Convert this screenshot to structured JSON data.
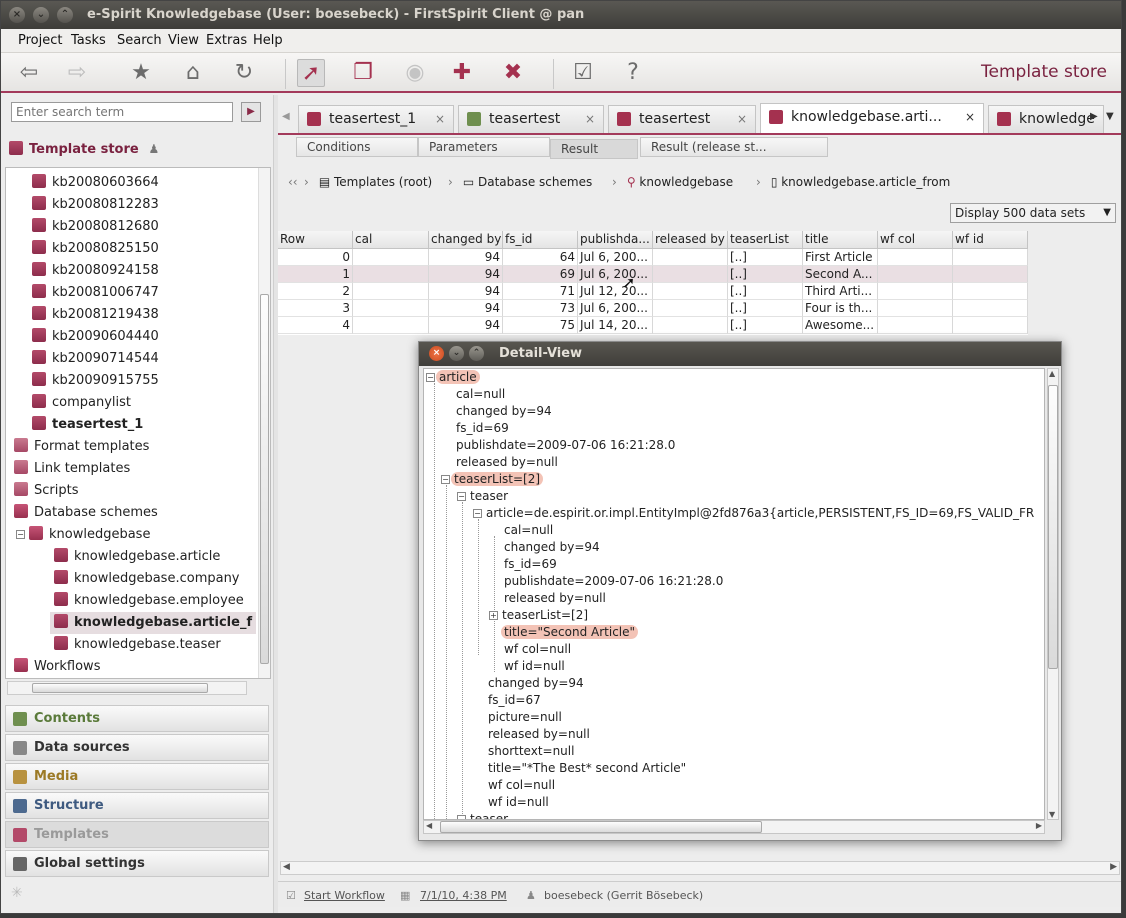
{
  "window": {
    "title": "e-Spirit Knowledgebase (User: boesebeck) - FirstSpirit Client @ pan"
  },
  "menu": [
    "Project",
    "Tasks",
    "Search",
    "View",
    "Extras",
    "Help"
  ],
  "toolbar": {
    "store_title": "Template store",
    "icons": [
      "back-icon",
      "forward-icon",
      "bookmark-star-icon",
      "home-icon",
      "refresh-icon",
      "select-pointer-icon",
      "copy-icon",
      "preview-icon",
      "new-template-icon",
      "delete-icon",
      "workflow-icon",
      "help-icon"
    ]
  },
  "sidebar": {
    "search_placeholder": "Enter search term",
    "store_title": "Template store",
    "tree": [
      {
        "label": "kb20080603664"
      },
      {
        "label": "kb20080812283"
      },
      {
        "label": "kb20080812680"
      },
      {
        "label": "kb20080825150"
      },
      {
        "label": "kb20080924158"
      },
      {
        "label": "kb20081006747"
      },
      {
        "label": "kb20081219438"
      },
      {
        "label": "kb20090604440"
      },
      {
        "label": "kb20090714544"
      },
      {
        "label": "kb20090915755"
      },
      {
        "label": "companylist"
      },
      {
        "label": "teasertest_1"
      },
      {
        "label": "Format templates"
      },
      {
        "label": "Link templates"
      },
      {
        "label": "Scripts"
      },
      {
        "label": "Database schemes"
      },
      {
        "label": "knowledgebase"
      },
      {
        "label": "knowledgebase.article"
      },
      {
        "label": "knowledgebase.company"
      },
      {
        "label": "knowledgebase.employee"
      },
      {
        "label": "knowledgebase.article_f"
      },
      {
        "label": "knowledgebase.teaser"
      },
      {
        "label": "Workflows"
      }
    ],
    "nav": [
      "Contents",
      "Data sources",
      "Media",
      "Structure",
      "Templates",
      "Global settings"
    ]
  },
  "editor": {
    "tabs": [
      "teasertest_1",
      "teasertest",
      "teasertest",
      "knowledgebase.arti...",
      "knowledge"
    ],
    "subtabs": [
      "Conditions",
      "Parameters",
      "Result",
      "Result (release st..."
    ],
    "breadcrumb": [
      "Templates (root)",
      "Database schemes",
      "knowledgebase",
      "knowledgebase.article_from"
    ],
    "display_select": "Display 500 data sets",
    "columns": [
      "Row",
      "cal",
      "changed by",
      "fs_id",
      "publishda...",
      "released by",
      "teaserList",
      "title",
      "wf col",
      "wf id"
    ],
    "rows": [
      [
        "0",
        "",
        "94",
        "64",
        "Jul 6, 200...",
        "",
        "[..]",
        "First Article",
        "",
        ""
      ],
      [
        "1",
        "",
        "94",
        "69",
        "Jul 6, 200...",
        "",
        "[..]",
        "Second A...",
        "",
        ""
      ],
      [
        "2",
        "",
        "94",
        "71",
        "Jul 12, 20...",
        "",
        "[..]",
        "Third Arti...",
        "",
        ""
      ],
      [
        "3",
        "",
        "94",
        "73",
        "Jul 6, 200...",
        "",
        "[..]",
        "Four is th...",
        "",
        ""
      ],
      [
        "4",
        "",
        "94",
        "75",
        "Jul 14, 20...",
        "",
        "[..]",
        "Awesome...",
        "",
        ""
      ]
    ],
    "status": {
      "workflow": "Start Workflow",
      "date": "7/1/10, 4:38 PM",
      "user": "boesebeck (Gerrit Bösebeck)"
    }
  },
  "detail_view": {
    "title": "Detail-View",
    "nodes": [
      "article",
      "cal=null",
      "changed by=94",
      "fs_id=69",
      "publishdate=2009-07-06 16:21:28.0",
      "released by=null",
      "teaserList=[2]",
      "teaser",
      "article=de.espirit.or.impl.EntityImpl@2fd876a3{article,PERSISTENT,FS_ID=69,FS_VALID_FR",
      "cal=null",
      "changed by=94",
      "fs_id=69",
      "publishdate=2009-07-06 16:21:28.0",
      "released by=null",
      "teaserList=[2]",
      "title=\"Second Article\"",
      "wf col=null",
      "wf id=null",
      "changed by=94",
      "fs_id=67",
      "picture=null",
      "released by=null",
      "shorttext=null",
      "title=\"*The Best* second Article\"",
      "wf col=null",
      "wf id=null",
      "teaser"
    ]
  }
}
